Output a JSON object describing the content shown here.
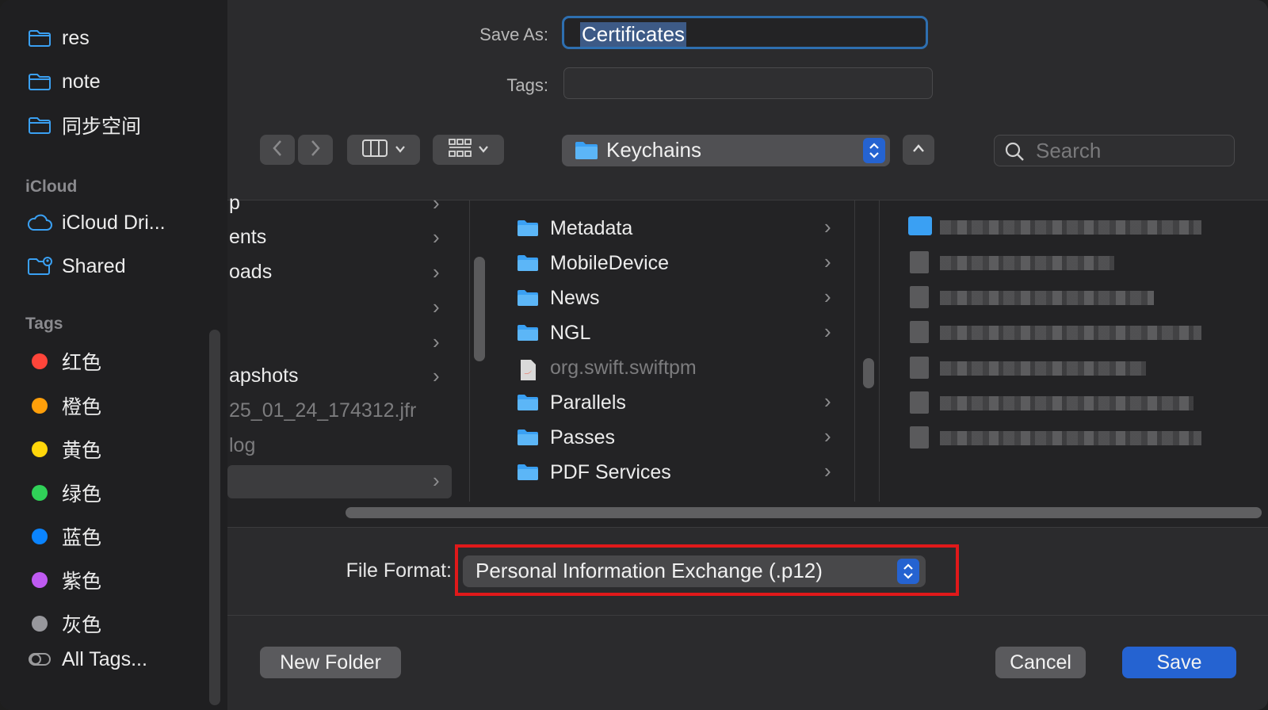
{
  "sidebar": {
    "favorites": [
      {
        "label": "res",
        "icon": "folder-icon"
      },
      {
        "label": "note",
        "icon": "folder-icon"
      },
      {
        "label": "同步空间",
        "icon": "folder-icon"
      }
    ],
    "icloud_header": "iCloud",
    "icloud": [
      {
        "label": "iCloud Dri...",
        "icon": "cloud-icon"
      },
      {
        "label": "Shared",
        "icon": "shared-folder-icon"
      }
    ],
    "tags_header": "Tags",
    "tags": [
      {
        "label": "红色",
        "color": "#ff453a"
      },
      {
        "label": "橙色",
        "color": "#ff9f0a"
      },
      {
        "label": "黄色",
        "color": "#ffd60a"
      },
      {
        "label": "绿色",
        "color": "#30d158"
      },
      {
        "label": "蓝色",
        "color": "#0a84ff"
      },
      {
        "label": "紫色",
        "color": "#bf5af2"
      },
      {
        "label": "灰色",
        "color": "#98989d"
      }
    ],
    "all_tags": "All Tags..."
  },
  "form": {
    "save_as_label": "Save As:",
    "save_as_value": "Certificates",
    "tags_label": "Tags:",
    "tags_value": ""
  },
  "toolbar": {
    "back_icon": "chevron-left-icon",
    "forward_icon": "chevron-right-icon",
    "view_icon": "column-view-icon",
    "group_icon": "grid-group-icon",
    "location": "Keychains",
    "search_placeholder": "Search"
  },
  "browser": {
    "col1": [
      {
        "label": "p",
        "chevron": true
      },
      {
        "label": "ents",
        "chevron": true
      },
      {
        "label": "oads",
        "chevron": true
      },
      {
        "label": "",
        "chevron": true
      },
      {
        "label": "",
        "chevron": true
      },
      {
        "label": "apshots",
        "chevron": true
      },
      {
        "label": "25_01_24_174312.jfr",
        "chevron": false,
        "dim": true
      },
      {
        "label": "log",
        "chevron": false,
        "dim": true
      },
      {
        "label": "",
        "chevron": true,
        "selected": true
      }
    ],
    "col2": [
      {
        "label": "Metadata",
        "type": "folder"
      },
      {
        "label": "MobileDevice",
        "type": "folder"
      },
      {
        "label": "News",
        "type": "folder"
      },
      {
        "label": "NGL",
        "type": "folder"
      },
      {
        "label": "org.swift.swiftpm",
        "type": "swift-file"
      },
      {
        "label": "Parallels",
        "type": "folder"
      },
      {
        "label": "Passes",
        "type": "folder"
      },
      {
        "label": "PDF Services",
        "type": "folder"
      }
    ]
  },
  "format": {
    "label": "File Format:",
    "value": "Personal Information Exchange (.p12)",
    "highlight_color": "#e0191a"
  },
  "buttons": {
    "new_folder": "New Folder",
    "cancel": "Cancel",
    "save": "Save"
  },
  "colors": {
    "accent": "#2563d1",
    "folder": "#3aa0f3"
  }
}
